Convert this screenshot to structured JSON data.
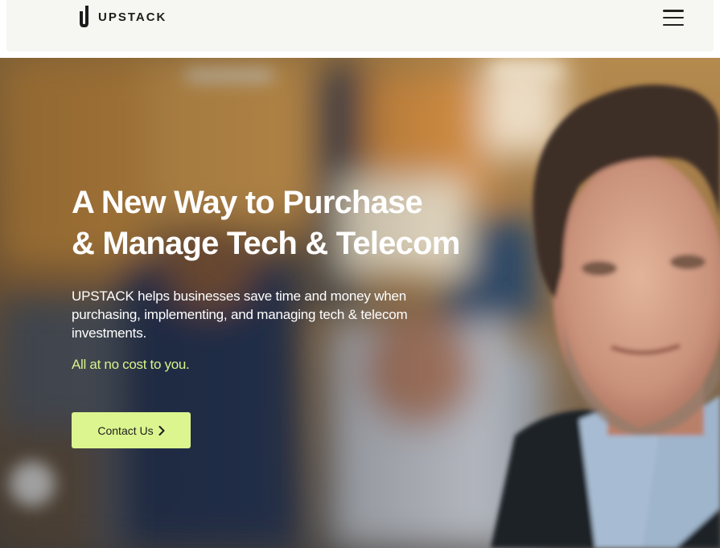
{
  "header": {
    "brand": "UPSTACK",
    "menu_icon": "hamburger-menu-icon"
  },
  "hero": {
    "title_line1": "A New Way to Purchase",
    "title_line2": "& Manage Tech & Telecom",
    "subtitle": "UPSTACK helps businesses save time and money when purchasing, implementing, and managing tech & telecom investments.",
    "note": "All at no cost to you.",
    "cta_label": "Contact Us",
    "cta_icon": "chevron-right-icon"
  },
  "colors": {
    "accent": "#dcf58f",
    "note_green": "#d8f28a",
    "header_bg": "#f6f6f2"
  }
}
